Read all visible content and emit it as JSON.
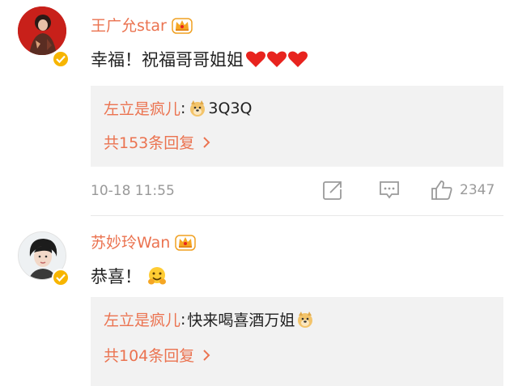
{
  "comments": [
    {
      "author": "王广允star",
      "text": "幸福！祝福哥哥姐姐",
      "reply": {
        "author": "左立是疯儿",
        "separator": ":",
        "text": "3Q3Q",
        "more_label": "共153条回复"
      },
      "time": "10-18 11:55",
      "likes": "2347"
    },
    {
      "author": "苏妙玲Wan",
      "text": "恭喜！",
      "reply": {
        "author": "左立是疯儿",
        "separator": ":",
        "text": "快来喝喜酒万姐",
        "more_label": "共104条回复"
      }
    }
  ],
  "icons": [
    "crown-icon",
    "verified-badge-icon",
    "heart-icon",
    "doge-emoji-icon",
    "hug-emoji-icon",
    "share-icon",
    "comment-icon",
    "like-icon",
    "chevron-right-icon"
  ],
  "colors": {
    "username": "#eb7350",
    "text": "#222222",
    "meta": "#999999",
    "reply_background": "#f2f2f2",
    "heart": "#e8231e",
    "verified": "#f7b500"
  }
}
